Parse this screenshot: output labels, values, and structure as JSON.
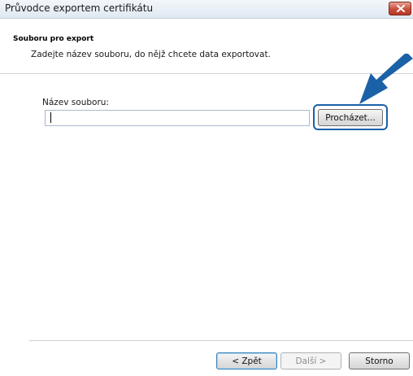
{
  "window": {
    "title": "Průvodce exportem certifikátu"
  },
  "header": {
    "title": "Souboru pro export",
    "subtitle": "Zadejte název souboru, do nějž chcete data exportovat."
  },
  "form": {
    "file_label": "Název souboru:",
    "file_value": "",
    "browse_label": "Procházet..."
  },
  "footer": {
    "back_label": "< Zpět",
    "next_label": "Další >",
    "cancel_label": "Storno"
  },
  "icons": {
    "close": "close-icon",
    "annotation": "arrow-pointer-icon"
  },
  "colors": {
    "annotation_arrow": "#1a61a8",
    "close_button": "#c94d3a"
  }
}
